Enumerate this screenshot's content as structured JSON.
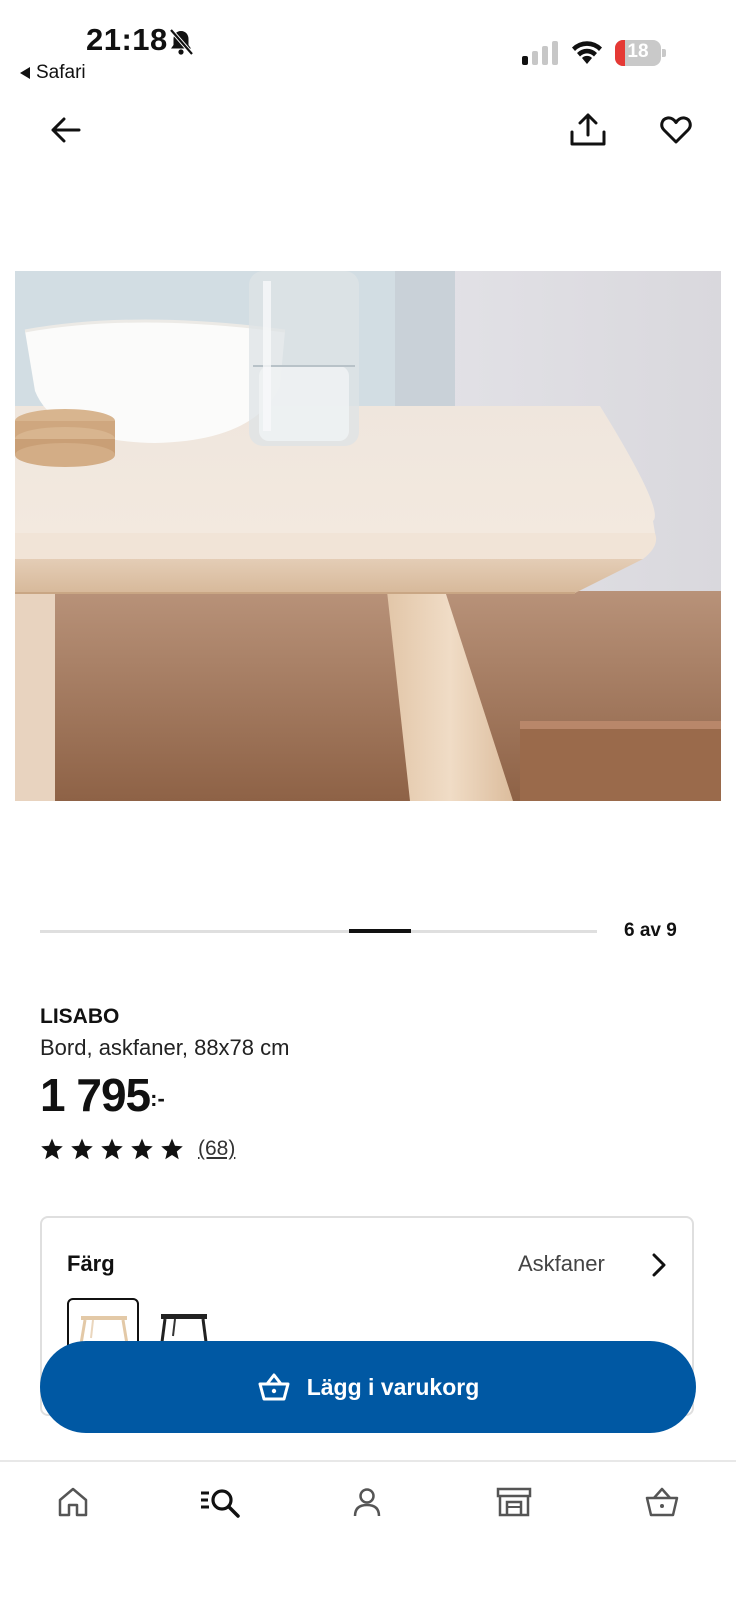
{
  "status_bar": {
    "time": "21:18",
    "back_app": "Safari",
    "battery": "18"
  },
  "nav": {
    "back_icon": "arrow-left-icon",
    "share_icon": "share-icon",
    "favorite_icon": "heart-icon"
  },
  "carousel": {
    "counter": "6 av 9",
    "current": 6,
    "total": 9
  },
  "product": {
    "brand": "LISABO",
    "description": "Bord, askfaner, 88x78 cm",
    "price": "1 795",
    "price_suffix": ":-",
    "rating": 5,
    "review_count": "(68)"
  },
  "color_option": {
    "label": "Färg",
    "value": "Askfaner"
  },
  "cta": {
    "label": "Lägg i varukorg"
  },
  "tabs": [
    "home-icon",
    "search-icon",
    "profile-icon",
    "store-icon",
    "basket-icon"
  ],
  "colors": {
    "primary": "#0058a3",
    "text": "#111111"
  }
}
